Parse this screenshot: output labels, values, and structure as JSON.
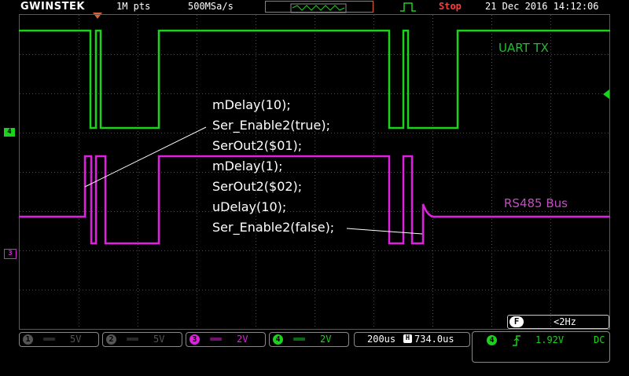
{
  "top": {
    "brand": "GWINSTEK",
    "memory_length": "1M pts",
    "sample_rate": "500MSa/s",
    "run_state": "Stop",
    "datetime": "21 Dec 2016 14:12:06"
  },
  "icons": [
    "trigger-edge-icon",
    "trigger-position-icon",
    "channel-4-ground-marker",
    "channel-3-ground-marker",
    "trigger-level-icon"
  ],
  "annotations": [
    "mDelay(10);",
    "Ser_Enable2(true);",
    "SerOut2($01);",
    "mDelay(1);",
    "SerOut2($02);",
    "uDelay(10);",
    "Ser_Enable2(false);"
  ],
  "trace_labels": {
    "ch4": "UART TX",
    "ch3": "RS485 Bus"
  },
  "markers": {
    "ch4": "4",
    "ch3": "3"
  },
  "colors": {
    "ch4": "#1bd31b",
    "ch3": "#e020e0",
    "annotation": "#ffffff",
    "stop": "#ff3b3b"
  },
  "bottom": {
    "ch1": {
      "num": "1",
      "scale": "5V"
    },
    "ch2": {
      "num": "2",
      "scale": "5V"
    },
    "ch3": {
      "num": "3",
      "scale": "2V"
    },
    "ch4": {
      "num": "4",
      "scale": "2V"
    },
    "timebase": "200us",
    "h_position": "734.0us",
    "freq_badge": "F",
    "freq": "<2Hz",
    "trigger": {
      "source": "4",
      "level": "1.92V",
      "coupling": "DC"
    }
  }
}
